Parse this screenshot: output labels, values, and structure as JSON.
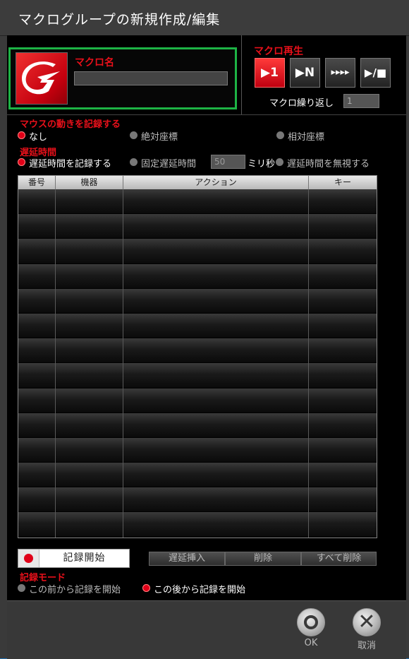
{
  "window": {
    "title": "マクログループの新規作成/編集"
  },
  "macro_name": {
    "label": "マクロ名",
    "value": ""
  },
  "playback": {
    "label": "マクロ再生",
    "buttons": [
      {
        "symbol": "▶1",
        "active": true
      },
      {
        "symbol": "▶N",
        "active": false
      },
      {
        "symbol": "▸▸▸▸",
        "active": false
      },
      {
        "symbol": "▶/■",
        "active": false
      }
    ],
    "repeat_label": "マクロ繰り返し",
    "repeat_value": "1"
  },
  "mouse": {
    "label": "マウスの動きを記録する",
    "options": [
      "なし",
      "絶対座標",
      "相対座標"
    ],
    "selected": "なし"
  },
  "delay": {
    "label": "遅延時間",
    "options": [
      "遅延時間を記録する",
      "固定遅延時間",
      "遅延時間を無視する"
    ],
    "selected": "遅延時間を記録する",
    "fixed_value": "50",
    "unit": "ミリ秒"
  },
  "table": {
    "columns": [
      "番号",
      "機器",
      "アクション",
      "キー"
    ],
    "row_count": 14
  },
  "actions": {
    "record_start": "記録開始",
    "insert_delay": "遅延挿入",
    "delete": "削除",
    "delete_all": "すべて削除"
  },
  "record_mode": {
    "label": "記録モード",
    "options": [
      "この前から記録を開始",
      "この後から記録を開始"
    ],
    "selected": "この後から記録を開始"
  },
  "footer": {
    "ok": "OK",
    "cancel": "取消"
  },
  "colors": {
    "accent_red": "#e8101a",
    "highlight_green": "#1db345"
  }
}
